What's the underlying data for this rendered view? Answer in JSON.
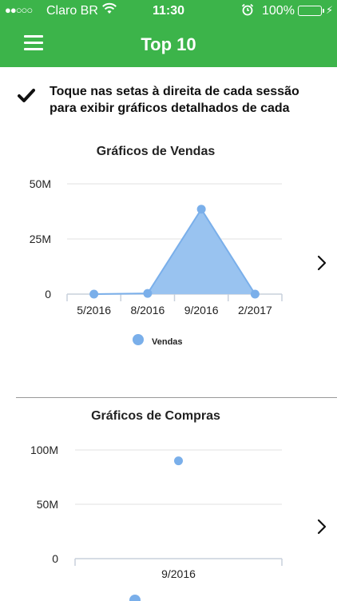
{
  "status": {
    "carrier": "Claro BR",
    "time": "11:30",
    "battery": "100%"
  },
  "nav": {
    "title": "Top 10"
  },
  "info": {
    "text": "Toque nas setas à direita de cada sessão para exibir gráficos detalhados de cada"
  },
  "charts": {
    "sales": {
      "title": "Gráficos de Vendas",
      "legend": "Vendas"
    },
    "purchases": {
      "title": "Gráficos de Compras"
    }
  },
  "colors": {
    "accent": "#3cb44a",
    "series": "#7aafea",
    "series_fill": "#99c3f0"
  },
  "chart_data": [
    {
      "type": "area",
      "title": "Gráficos de Vendas",
      "categories": [
        "5/2016",
        "8/2016",
        "9/2016",
        "2/2017"
      ],
      "y_ticks": [
        "0",
        "25M",
        "50M"
      ],
      "ylim": [
        0,
        50000000
      ],
      "grid": true,
      "legend": "bottom",
      "series": [
        {
          "name": "Vendas",
          "values": [
            0,
            300000,
            38500000,
            0
          ]
        }
      ]
    },
    {
      "type": "scatter",
      "title": "Gráficos de Compras",
      "categories": [
        "9/2016"
      ],
      "y_ticks": [
        "0",
        "50M",
        "100M"
      ],
      "ylim": [
        0,
        100000000
      ],
      "grid": true,
      "legend": "bottom",
      "series": [
        {
          "values": [
            90000000
          ]
        }
      ]
    }
  ]
}
